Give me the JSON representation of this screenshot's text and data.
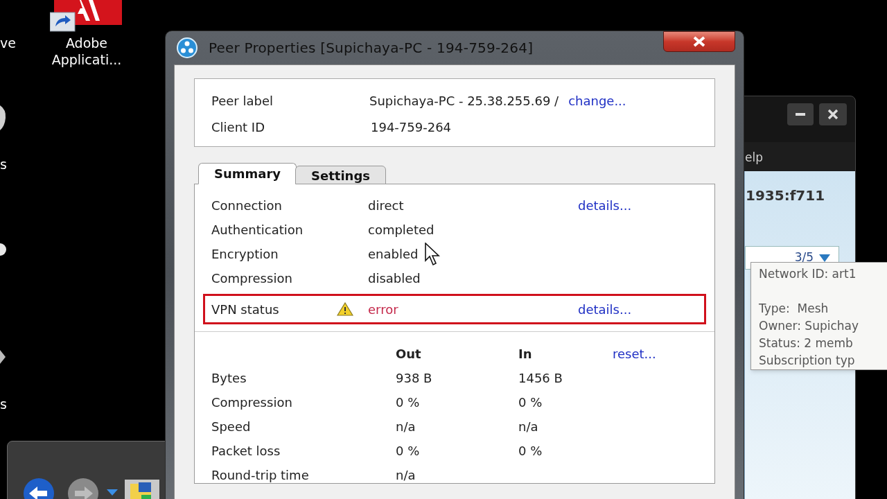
{
  "desktop": {
    "edge_labels": [
      "ve",
      "s",
      "s"
    ],
    "shortcut": {
      "label": "Adobe Applicati..."
    }
  },
  "dialog": {
    "title": "Peer Properties [Supichaya-PC - 194-759-264]",
    "peer": {
      "label_caption": "Peer label",
      "label_value": "Supichaya-PC - 25.38.255.69 /",
      "change_link": "change...",
      "client_caption": "Client ID",
      "client_value": "194-759-264"
    },
    "tabs": [
      {
        "label": "Summary",
        "selected": true
      },
      {
        "label": "Settings",
        "selected": false
      }
    ],
    "summary": [
      {
        "label": "Connection",
        "value": "direct",
        "link": "details...",
        "warning": false,
        "highlighted": false
      },
      {
        "label": "Authentication",
        "value": "completed",
        "warning": false,
        "highlighted": false
      },
      {
        "label": "Encryption",
        "value": "enabled",
        "warning": false,
        "highlighted": false
      },
      {
        "label": "Compression",
        "value": "disabled",
        "warning": false,
        "highlighted": false
      },
      {
        "label": "VPN status",
        "value": "error",
        "link": "details...",
        "warning": true,
        "highlighted": true
      }
    ],
    "stats": {
      "columns": [
        "Out",
        "In"
      ],
      "reset_link": "reset...",
      "rows": [
        {
          "label": "Bytes",
          "out": "938 B",
          "in": "1456 B"
        },
        {
          "label": "Compression",
          "out": "0 %",
          "in": "0 %"
        },
        {
          "label": "Speed",
          "out": "n/a",
          "in": "n/a"
        },
        {
          "label": "Packet loss",
          "out": "0 %",
          "in": "0 %"
        },
        {
          "label": "Round-trip time",
          "out": "n/a"
        }
      ]
    }
  },
  "background_window": {
    "menu_text": "elp",
    "address": "1935:f711",
    "counter": "3/5"
  },
  "tooltip": {
    "header": "Network ID: art1",
    "lines": [
      "Type:  Mesh",
      "Owner: Supichay",
      "Status: 2 memb",
      "Subscription typ"
    ]
  }
}
